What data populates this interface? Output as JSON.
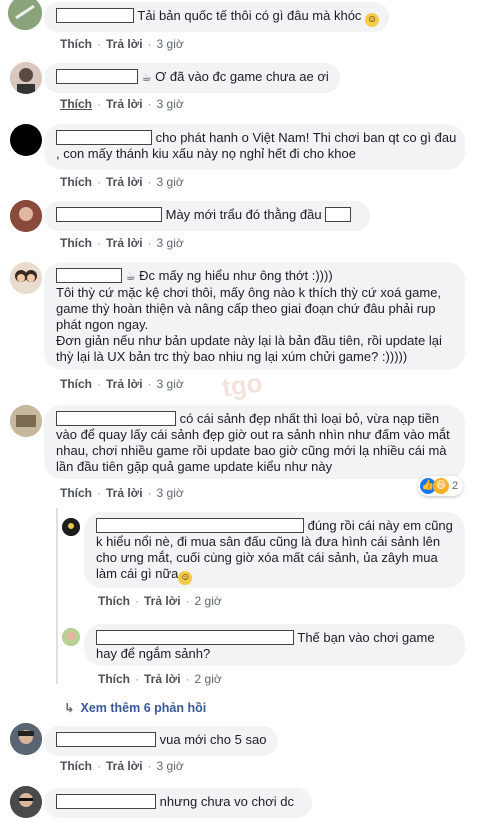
{
  "actions": {
    "like": "Thích",
    "reply": "Trả lời",
    "separator": "·"
  },
  "comments": [
    {
      "text": "Tải bản quốc tế thôi có gì đâu mà khóc",
      "time": "3 giờ"
    },
    {
      "text": "Ơ đã vào đc game chưa ae ơi",
      "time": "3 giờ"
    },
    {
      "text_line1": "cho phát hanh o Việt Nam! Thi chơi ban qt co gì đau",
      "text_line2": ", con mấy thánh kiu xấu này nọ nghỉ hết đi cho khoe",
      "time": "3 giờ"
    },
    {
      "text": "Mày mới trẩu đó thằng đầu",
      "time": "3 giờ"
    },
    {
      "line1": "Đc mấy ng hiểu như ông thớt :))))",
      "line2": "Tôi thỳ cứ mặc kệ chơi thôi, mấy ông nào k thích thỳ cứ xoá game,",
      "line3": "game thỳ hoàn thiện và nâng cấp theo giai đoạn chứ đâu phải rup",
      "line4": "phát ngon ngay.",
      "line5": "Đơn giản nếu như bản update này lại là bản đầu tiên, rồi update lại",
      "line6": "thỳ lại là UX bản trc thỳ bao nhiu ng lại xúm chửi game? :)))))",
      "time": "3 giờ"
    },
    {
      "line1": "có cái sảnh đẹp nhất thì loại bỏ, vừa nạp tiền",
      "line2": "vào để quay lấy cái sảnh đẹp giờ out ra sảnh nhìn như đấm vào mắt",
      "line3": "nhau, chơi nhiều game rồi update bao giờ cũng mới lạ nhiều cái mà",
      "line4": "lần đầu tiên gặp quả game update kiểu như này",
      "time": "3 giờ",
      "reaction_count": "2"
    },
    {
      "line1": "đúng rồi cái này em cũng",
      "line2": "k hiểu nổi nè, đi mua sân đấu cũng là đưa hình cái sảnh lên",
      "line3": "cho ưng mắt, cuối cùng giờ xóa mất cái sảnh, ủa zâyh mua",
      "line4": "làm cái gì nữa",
      "time": "2 giờ"
    },
    {
      "line1": "Thế bạn vào chơi game",
      "line2": "hay để ngắm sảnh?",
      "time": "2 giờ"
    },
    {
      "text": "vua mới cho 5 sao",
      "time": "3 giờ"
    },
    {
      "text": "nhưng chưa vo chơi dc"
    }
  ],
  "more_replies": "Xem thêm 6 phản hồi",
  "colors": {
    "bubble": "#f2f3f5",
    "link": "#385898",
    "muted": "#606770"
  }
}
